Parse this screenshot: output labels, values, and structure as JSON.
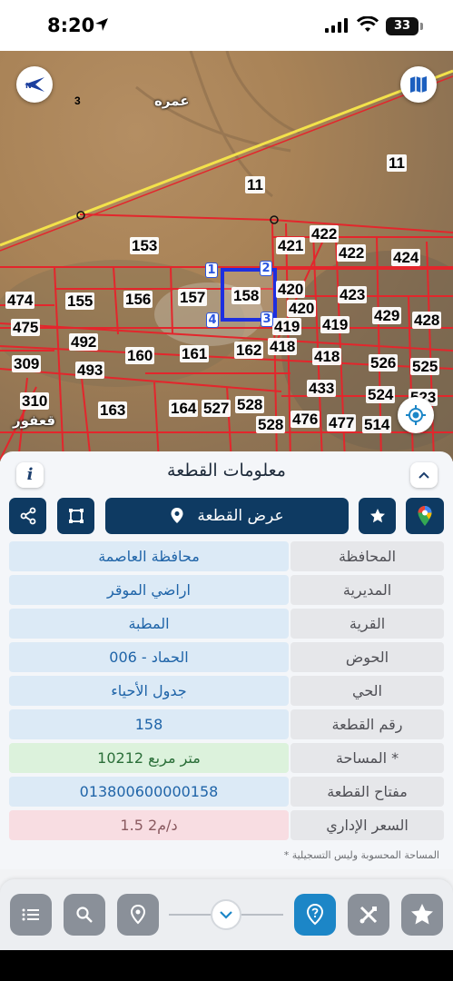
{
  "status_bar": {
    "time": "8:20",
    "battery": "33"
  },
  "map": {
    "places": {
      "amra": "عمره",
      "agfour": "قعفور"
    },
    "plots": [
      {
        "id": "p3",
        "label": "3"
      },
      {
        "id": "p11a",
        "label": "11"
      },
      {
        "id": "p11b",
        "label": "11"
      },
      {
        "id": "p153",
        "label": "153"
      },
      {
        "id": "p422a",
        "label": "422"
      },
      {
        "id": "p421",
        "label": "421"
      },
      {
        "id": "p422b",
        "label": "422"
      },
      {
        "id": "p424",
        "label": "424"
      },
      {
        "id": "p474",
        "label": "474"
      },
      {
        "id": "p155",
        "label": "155"
      },
      {
        "id": "p156",
        "label": "156"
      },
      {
        "id": "p157",
        "label": "157"
      },
      {
        "id": "p158",
        "label": "158"
      },
      {
        "id": "p420a",
        "label": "420"
      },
      {
        "id": "p423",
        "label": "423"
      },
      {
        "id": "p420b",
        "label": "420"
      },
      {
        "id": "p429",
        "label": "429"
      },
      {
        "id": "p428",
        "label": "428"
      },
      {
        "id": "p475",
        "label": "475"
      },
      {
        "id": "p419a",
        "label": "419"
      },
      {
        "id": "p419b",
        "label": "419"
      },
      {
        "id": "p492",
        "label": "492"
      },
      {
        "id": "p418a",
        "label": "418"
      },
      {
        "id": "p160",
        "label": "160"
      },
      {
        "id": "p161",
        "label": "161"
      },
      {
        "id": "p162",
        "label": "162"
      },
      {
        "id": "p418b",
        "label": "418"
      },
      {
        "id": "p309",
        "label": "309"
      },
      {
        "id": "p493",
        "label": "493"
      },
      {
        "id": "p526",
        "label": "526"
      },
      {
        "id": "p525",
        "label": "525"
      },
      {
        "id": "p433",
        "label": "433"
      },
      {
        "id": "p310",
        "label": "310"
      },
      {
        "id": "p524",
        "label": "524"
      },
      {
        "id": "p523",
        "label": "523"
      },
      {
        "id": "p163",
        "label": "163"
      },
      {
        "id": "p164",
        "label": "164"
      },
      {
        "id": "p527",
        "label": "527"
      },
      {
        "id": "p528a",
        "label": "528"
      },
      {
        "id": "p528b",
        "label": "528"
      },
      {
        "id": "p476",
        "label": "476"
      },
      {
        "id": "p477",
        "label": "477"
      },
      {
        "id": "p514",
        "label": "514"
      }
    ],
    "vertices": [
      "1",
      "2",
      "3",
      "4"
    ],
    "colors": {
      "parcel_lines": "#e3262c",
      "selected_parcel": "#1d2fe0",
      "road": "#f3e24b"
    }
  },
  "panel": {
    "title": "معلومات القطعة",
    "show_plot_label": "عرض القطعة",
    "rows": [
      {
        "label": "المحافظة",
        "value": "محافظة العاصمة",
        "style": "blue"
      },
      {
        "label": "المديرية",
        "value": "اراضي الموقر",
        "style": "blue"
      },
      {
        "label": "القرية",
        "value": "المطبة",
        "style": "blue"
      },
      {
        "label": "الحوض",
        "value": "الحماد - 006",
        "style": "blue"
      },
      {
        "label": "الحي",
        "value": "جدول الأحياء",
        "style": "blue"
      },
      {
        "label": "رقم القطعة",
        "value": "158",
        "style": "blue"
      },
      {
        "label": "المساحة *",
        "value": "10212  متر مربع",
        "style": "green"
      },
      {
        "label": "مفتاح القطعة",
        "value": "013800600000158",
        "style": "blue"
      },
      {
        "label": "السعر الإداري",
        "value": "1.5 د/م2",
        "style": "pink"
      }
    ],
    "footnote": "* المساحة المحسوبة وليس التسجيلية"
  },
  "icons": {
    "compass": "compass-icon",
    "map_layers": "map-icon",
    "locate": "locate-icon",
    "info": "info-icon",
    "collapse": "chevron-up-icon",
    "maps": "google-maps-icon",
    "favorite": "star-icon",
    "show_plot": "location-pin-icon",
    "measure": "crop-frame-icon",
    "share": "share-icon",
    "list": "list-icon",
    "search": "search-icon",
    "pin_search": "pin-search-icon",
    "slider": "chevron-down-icon",
    "help": "question-pin-icon",
    "tools": "tools-icon",
    "badge": "badge-star-icon"
  }
}
